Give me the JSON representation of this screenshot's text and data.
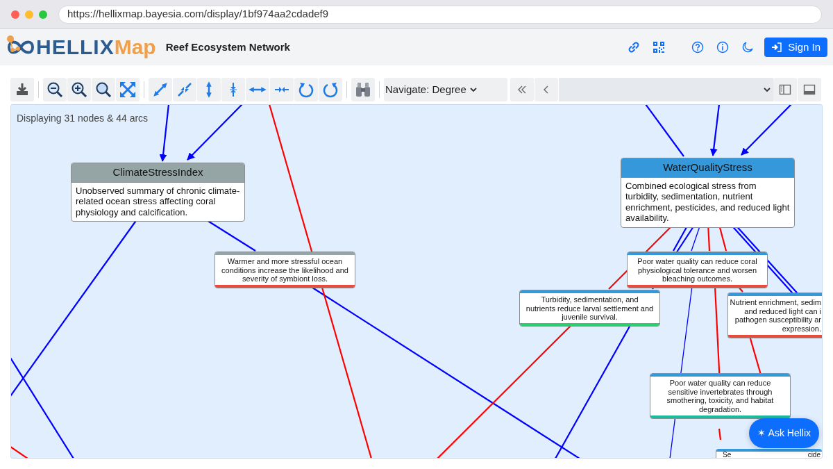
{
  "browser": {
    "url": "https://hellixmap.bayesia.com/display/1bf974aa2cdadef9"
  },
  "header": {
    "logo": {
      "primary": "HELLIX",
      "accent": "Map"
    },
    "title": "Reef Ecosystem Network",
    "sign_in": "Sign In"
  },
  "toolbar": {
    "navigate": "Navigate: Degree"
  },
  "canvas": {
    "summary": "Displaying 31 nodes & 44 arcs",
    "nodes": [
      {
        "kind": "variable",
        "title": "ClimateStressIndex",
        "text": "Unobserved summary of chronic climate-related ocean stress affecting coral physiology and calcification.",
        "color": "#95a5a6"
      },
      {
        "kind": "variable",
        "title": "WaterQualityStress",
        "text": "Combined ecological stress from turbidity, sedimentation, nutrient enrichment, pesticides, and reduced light availability.",
        "color": "#3498db"
      },
      {
        "kind": "arc-label",
        "lines": [
          "Warmer and more stressful ocean",
          "conditions increase the likelihood and",
          "severity of symbiont loss."
        ],
        "color": "#95a5a6",
        "effect": {
          "color": "#e74c3c"
        }
      },
      {
        "kind": "arc-label",
        "lines": [
          "Poor water quality can reduce coral",
          "physiological tolerance and worsen",
          "bleaching outcomes."
        ],
        "color": "#3498db",
        "effect": {
          "color": "#e74c3c"
        }
      },
      {
        "kind": "arc-label",
        "lines": [
          "Turbidity, sedimentation, and",
          "nutrients reduce larval settlement and",
          "juvenile survival."
        ],
        "color": "#3498db",
        "effect": {
          "color": "#2ecc71"
        }
      },
      {
        "kind": "clipped",
        "lines": [
          "Nutrient enrichment, sedim",
          "and reduced light can i",
          "pathogen susceptibility ar",
          "expression."
        ],
        "color": "#3498db",
        "effect": {
          "color": "#e74c3c"
        }
      },
      {
        "kind": "arc-label",
        "lines": [
          "Poor water quality can reduce",
          "sensitive invertebrates through",
          "smothering, toxicity, and habitat",
          "degradation."
        ],
        "color": "#3498db",
        "effect": {
          "color": "#1abc9c"
        }
      },
      {
        "kind": "fragment",
        "lines": [
          "Se",
          "cide"
        ],
        "color": "#3498db"
      }
    ]
  },
  "ask_button": "✶ Ask Hellix"
}
